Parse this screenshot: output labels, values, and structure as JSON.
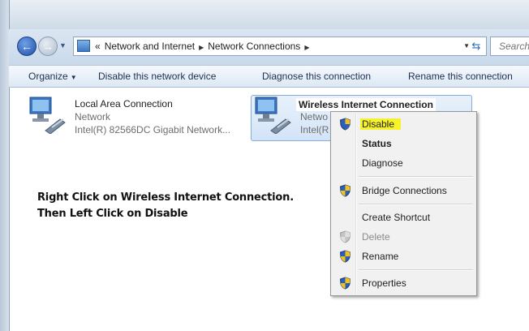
{
  "address": {
    "overflow": "«",
    "crumbs": [
      "Network and Internet",
      "Network Connections"
    ],
    "search_placeholder": "Search"
  },
  "toolbar": {
    "organize": "Organize",
    "disable_device": "Disable this network device",
    "diagnose": "Diagnose this connection",
    "rename": "Rename this connection"
  },
  "connections": {
    "lan": {
      "title": "Local Area Connection",
      "status": "Network",
      "device": "Intel(R) 82566DC Gigabit Network..."
    },
    "wireless": {
      "title": "Wireless Internet Connection",
      "status_partial": "Netwo",
      "device_partial": "Intel(R"
    }
  },
  "annotation": {
    "line1": "Right Click on Wireless Internet Connection.",
    "line2": "Then Left Click on Disable"
  },
  "context_menu": {
    "disable": "Disable",
    "status": "Status",
    "diagnose": "Diagnose",
    "bridge": "Bridge Connections",
    "shortcut": "Create Shortcut",
    "delete": "Delete",
    "rename": "Rename",
    "properties": "Properties"
  },
  "colors": {
    "highlight": "#f7f32a",
    "selection": "#d3e4f7",
    "toolbar_text": "#1e3050"
  }
}
